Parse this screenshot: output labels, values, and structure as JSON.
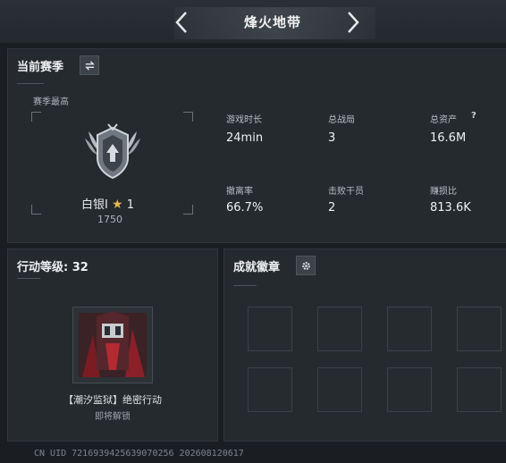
{
  "header": {
    "title": "烽火地带"
  },
  "season": {
    "title": "当前赛季",
    "best_label": "赛季最高",
    "rank_name": "白银I",
    "rank_stars": "1",
    "rank_points": "1750",
    "stats": [
      {
        "label": "游戏时长",
        "value": "24min"
      },
      {
        "label": "总战局",
        "value": "3"
      },
      {
        "label": "总资产",
        "value": "16.6M"
      },
      {
        "label": "撤离率",
        "value": "66.7%"
      },
      {
        "label": "击败干员",
        "value": "2"
      },
      {
        "label": "赚损比",
        "value": "813.6K"
      }
    ]
  },
  "action": {
    "title": "行动等级: 32",
    "operation_name": "【潮汐监狱】绝密行动",
    "operation_status": "即将解锁"
  },
  "achievements": {
    "title": "成就徽章"
  },
  "footer": {
    "uid": "CN UID 7216939425639070256 202608120617"
  },
  "colors": {
    "accent": "#e8b64a",
    "panel": "#252a2f",
    "background": "#1a1e22"
  }
}
